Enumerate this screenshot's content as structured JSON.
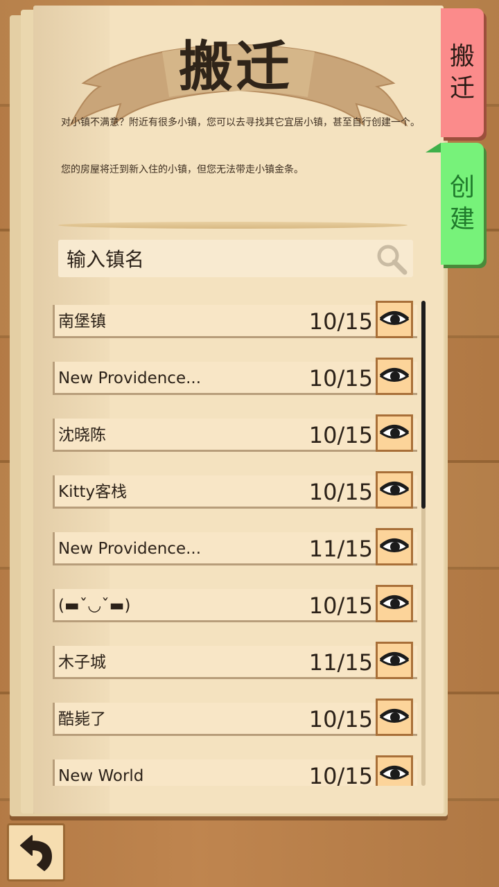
{
  "header": {
    "title": "搬迁",
    "desc_line1": "对小镇不满意？附近有很多小镇，您可以去寻找其它宜居小镇，甚至自行创建一个。",
    "desc_line2": "您的房屋将迁到新入住的小镇，但您无法带走小镇金条。"
  },
  "tabs": {
    "move_char1": "搬",
    "move_char2": "迁",
    "create_char1": "创",
    "create_char2": "建"
  },
  "search": {
    "placeholder": "输入镇名",
    "icon": "search-icon"
  },
  "towns": [
    {
      "name": "南堡镇",
      "count": "10/15"
    },
    {
      "name": "New Providence...",
      "count": "10/15"
    },
    {
      "name": "沈晓陈",
      "count": "10/15"
    },
    {
      "name": "Kitty客栈",
      "count": "10/15"
    },
    {
      "name": "New Providence...",
      "count": "11/15"
    },
    {
      "name": "(▬ˇ◡ˇ▬)",
      "count": "10/15"
    },
    {
      "name": "木子城",
      "count": "11/15"
    },
    {
      "name": "酷毙了",
      "count": "10/15"
    },
    {
      "name": "New World",
      "count": "10/15"
    }
  ],
  "icons": {
    "view": "eye-icon",
    "back": "back-arrow-icon"
  },
  "colors": {
    "tab_move": "#fb8b8b",
    "tab_create": "#77f27a",
    "page": "#f4e2bf",
    "button": "#fcd49a"
  }
}
